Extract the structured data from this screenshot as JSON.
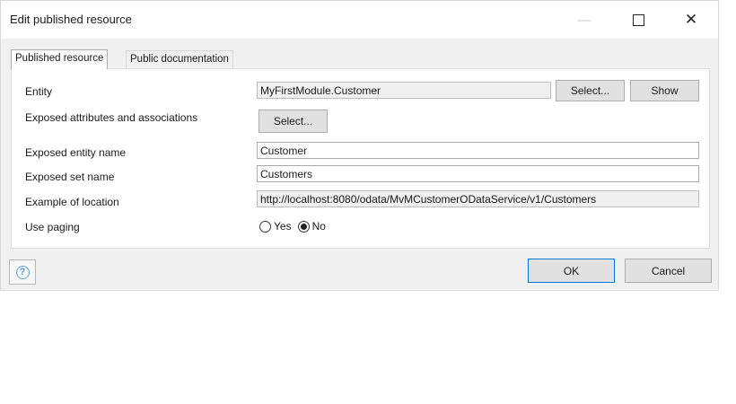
{
  "window": {
    "title": "Edit published resource",
    "minimize_icon": "minimize-icon",
    "maximize_icon": "maximize-icon",
    "close_glyph": "✕"
  },
  "tabs": [
    {
      "label": "Published resource",
      "active": true
    },
    {
      "label": "Public documentation",
      "active": false
    }
  ],
  "form": {
    "entity": {
      "label": "Entity",
      "value": "MyFirstModule.Customer",
      "select_label": "Select...",
      "show_label": "Show"
    },
    "exposed_attributes": {
      "label": "Exposed attributes and associations",
      "select_label": "Select..."
    },
    "exposed_entity_name": {
      "label": "Exposed entity name",
      "value": "Customer"
    },
    "exposed_set_name": {
      "label": "Exposed set name",
      "value": "Customers"
    },
    "example_location": {
      "label": "Example of location",
      "value": "http://localhost:8080/odata/MvMCustomerODataService/v1/Customers"
    },
    "use_paging": {
      "label": "Use paging",
      "options": [
        "Yes",
        "No"
      ],
      "selected": "No"
    }
  },
  "footer": {
    "help_glyph": "?",
    "ok_label": "OK",
    "cancel_label": "Cancel"
  },
  "colors": {
    "dialog_bg": "#f0f0f0",
    "accent": "#0078d7",
    "help_icon": "#5b9bd5"
  }
}
